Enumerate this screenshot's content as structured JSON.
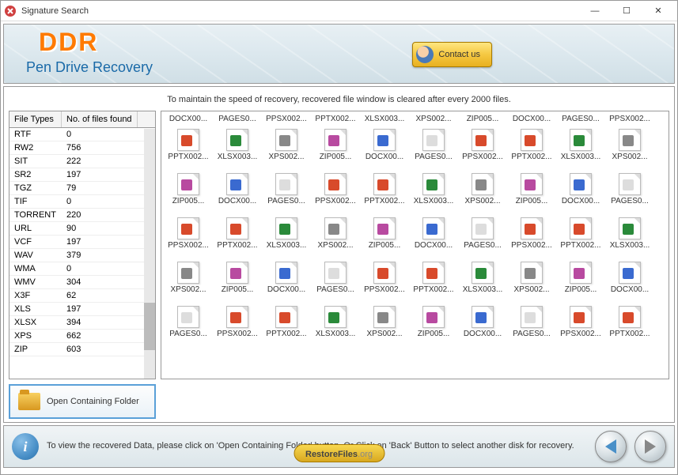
{
  "window": {
    "title": "Signature Search"
  },
  "header": {
    "brand": "DDR",
    "subtitle": "Pen Drive Recovery",
    "contact": "Contact us"
  },
  "notice": "To maintain the speed of recovery, recovered file window is cleared after every 2000 files.",
  "file_types_table": {
    "headers": [
      "File Types",
      "No. of files found"
    ],
    "rows": [
      {
        "type": "RTF",
        "count": "0"
      },
      {
        "type": "RW2",
        "count": "756"
      },
      {
        "type": "SIT",
        "count": "222"
      },
      {
        "type": "SR2",
        "count": "197"
      },
      {
        "type": "TGZ",
        "count": "79"
      },
      {
        "type": "TIF",
        "count": "0"
      },
      {
        "type": "TORRENT",
        "count": "220"
      },
      {
        "type": "URL",
        "count": "90"
      },
      {
        "type": "VCF",
        "count": "197"
      },
      {
        "type": "WAV",
        "count": "379"
      },
      {
        "type": "WMA",
        "count": "0"
      },
      {
        "type": "WMV",
        "count": "304"
      },
      {
        "type": "X3F",
        "count": "62"
      },
      {
        "type": "XLS",
        "count": "197"
      },
      {
        "type": "XLSX",
        "count": "394"
      },
      {
        "type": "XPS",
        "count": "662"
      },
      {
        "type": "ZIP",
        "count": "603"
      }
    ]
  },
  "files_grid": [
    [
      {
        "label": "DOCX00...",
        "badge": ""
      },
      {
        "label": "PAGES0...",
        "badge": ""
      },
      {
        "label": "PPSX002...",
        "badge": ""
      },
      {
        "label": "PPTX002...",
        "badge": ""
      },
      {
        "label": "XLSX003...",
        "badge": ""
      },
      {
        "label": "XPS002...",
        "badge": ""
      },
      {
        "label": "ZIP005...",
        "badge": ""
      },
      {
        "label": "DOCX00...",
        "badge": ""
      },
      {
        "label": "PAGES0...",
        "badge": ""
      },
      {
        "label": "PPSX002...",
        "badge": ""
      }
    ],
    [
      {
        "label": "PPTX002...",
        "badge": "ppt"
      },
      {
        "label": "XLSX003...",
        "badge": "xls"
      },
      {
        "label": "XPS002...",
        "badge": "xps"
      },
      {
        "label": "ZIP005...",
        "badge": "zip"
      },
      {
        "label": "DOCX00...",
        "badge": "doc"
      },
      {
        "label": "PAGES0...",
        "badge": "pg"
      },
      {
        "label": "PPSX002...",
        "badge": "ppt"
      },
      {
        "label": "PPTX002...",
        "badge": "ppt"
      },
      {
        "label": "XLSX003...",
        "badge": "xls"
      },
      {
        "label": "XPS002...",
        "badge": "xps"
      }
    ],
    [
      {
        "label": "ZIP005...",
        "badge": "zip"
      },
      {
        "label": "DOCX00...",
        "badge": "doc"
      },
      {
        "label": "PAGES0...",
        "badge": "pg"
      },
      {
        "label": "PPSX002...",
        "badge": "ppt"
      },
      {
        "label": "PPTX002...",
        "badge": "ppt"
      },
      {
        "label": "XLSX003...",
        "badge": "xls"
      },
      {
        "label": "XPS002...",
        "badge": "xps"
      },
      {
        "label": "ZIP005...",
        "badge": "zip"
      },
      {
        "label": "DOCX00...",
        "badge": "doc"
      },
      {
        "label": "PAGES0...",
        "badge": "pg"
      }
    ],
    [
      {
        "label": "PPSX002...",
        "badge": "ppt"
      },
      {
        "label": "PPTX002...",
        "badge": "ppt"
      },
      {
        "label": "XLSX003...",
        "badge": "xls"
      },
      {
        "label": "XPS002...",
        "badge": "xps"
      },
      {
        "label": "ZIP005...",
        "badge": "zip"
      },
      {
        "label": "DOCX00...",
        "badge": "doc"
      },
      {
        "label": "PAGES0...",
        "badge": "pg"
      },
      {
        "label": "PPSX002...",
        "badge": "ppt"
      },
      {
        "label": "PPTX002...",
        "badge": "ppt"
      },
      {
        "label": "XLSX003...",
        "badge": "xls"
      }
    ],
    [
      {
        "label": "XPS002...",
        "badge": "xps"
      },
      {
        "label": "ZIP005...",
        "badge": "zip"
      },
      {
        "label": "DOCX00...",
        "badge": "doc"
      },
      {
        "label": "PAGES0...",
        "badge": "pg"
      },
      {
        "label": "PPSX002...",
        "badge": "ppt"
      },
      {
        "label": "PPTX002...",
        "badge": "ppt"
      },
      {
        "label": "XLSX003...",
        "badge": "xls"
      },
      {
        "label": "XPS002...",
        "badge": "xps"
      },
      {
        "label": "ZIP005...",
        "badge": "zip"
      },
      {
        "label": "DOCX00...",
        "badge": "doc"
      }
    ],
    [
      {
        "label": "PAGES0...",
        "badge": "pg"
      },
      {
        "label": "PPSX002...",
        "badge": "ppt"
      },
      {
        "label": "PPTX002...",
        "badge": "ppt"
      },
      {
        "label": "XLSX003...",
        "badge": "xls"
      },
      {
        "label": "XPS002...",
        "badge": "xps"
      },
      {
        "label": "ZIP005...",
        "badge": "zip"
      },
      {
        "label": "DOCX00...",
        "badge": "doc"
      },
      {
        "label": "PAGES0...",
        "badge": "pg"
      },
      {
        "label": "PPSX002...",
        "badge": "ppt"
      },
      {
        "label": "PPTX002...",
        "badge": "ppt"
      }
    ]
  ],
  "open_button": "Open Containing Folder",
  "footer_text": "To view the recovered Data, please click on 'Open Containing Folder' button. Or Click on 'Back' Button to select another disk for recovery.",
  "restore_badge": {
    "name": "RestoreFiles",
    "tld": ".org"
  }
}
